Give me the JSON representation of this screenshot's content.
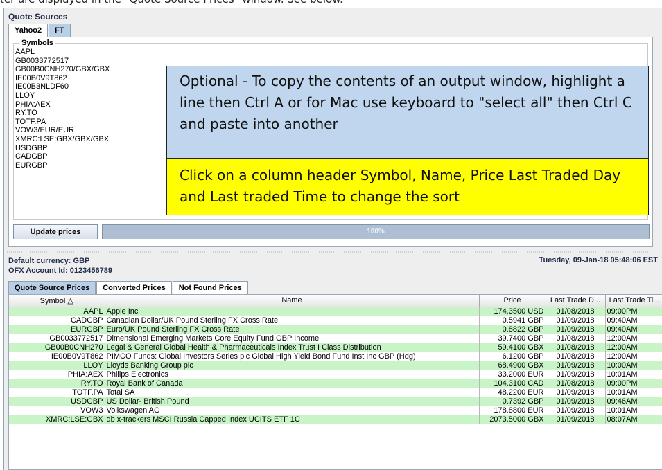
{
  "top_caption": "ter are displayed in the \"Quote Source Prices\" window. See below.",
  "quote_sources": {
    "title": "Quote Sources",
    "tabs": [
      "Yahoo2",
      "FT"
    ],
    "symbols_label": "Symbols",
    "symbols": [
      "AAPL",
      "GB0033772517",
      "GB00B0CNH270/GBX/GBX",
      "IE00B0V9T862",
      "IE00B3NLDF60",
      "LLOY",
      "PHIA:AEX",
      "RY.TO",
      "TOTF.PA",
      "VOW3/EUR/EUR",
      "XMRC:LSE:GBX/GBX/GBX",
      "USDGBP",
      "CADGBP",
      "EURGBP"
    ],
    "update_button": "Update prices",
    "progress_percent": 100,
    "progress_label": "100%"
  },
  "callouts": {
    "blue": "Optional - To copy the contents of an output window, highlight a line then Ctrl A or for Mac use keyboard to \"select all\" then Ctrl C and paste into another",
    "yellow": "Click on a column header Symbol, Name, Price Last Traded Day and Last traded Time to change the sort"
  },
  "info": {
    "default_currency": "Default currency: GBP",
    "ofx_account": "OFX Account Id: 0123456789",
    "timestamp": "Tuesday, 09-Jan-18 05:48:06 EST"
  },
  "price_tabs": [
    "Quote Source Prices",
    "Converted Prices",
    "Not Found Prices"
  ],
  "table": {
    "columns": [
      "Symbol △",
      "Name",
      "Price",
      "Last Trade D...",
      "Last Trade Ti..."
    ],
    "rows": [
      [
        "AAPL",
        "Apple Inc",
        "174.3500 USD",
        "01/08/2018",
        "09:00PM"
      ],
      [
        "CADGBP",
        "Canadian Dollar/UK Pound Sterling FX Cross Rate",
        "0.5941 GBP",
        "01/09/2018",
        "09:40AM"
      ],
      [
        "EURGBP",
        "Euro/UK Pound Sterling FX Cross Rate",
        "0.8822 GBP",
        "01/09/2018",
        "09:40AM"
      ],
      [
        "GB0033772517",
        "Dimensional Emerging Markets Core Equity Fund GBP Income",
        "39.7400 GBP",
        "01/08/2018",
        "12:00AM"
      ],
      [
        "GB00B0CNH270",
        "Legal & General Global Health & Pharmaceuticals Index Trust I Class Distribution",
        "59.4100 GBX",
        "01/08/2018",
        "12:00AM"
      ],
      [
        "IE00B0V9T862",
        "PIMCO Funds: Global Investors Series plc Global High Yield Bond Fund Inst Inc GBP (Hdg)",
        "6.1200 GBP",
        "01/08/2018",
        "12:00AM"
      ],
      [
        "LLOY",
        "Lloyds Banking Group plc",
        "68.4900 GBX",
        "01/09/2018",
        "10:00AM"
      ],
      [
        "PHIA:AEX",
        "Philips Electronics",
        "33.2000 EUR",
        "01/09/2018",
        "10:01AM"
      ],
      [
        "RY.TO",
        "Royal Bank of Canada",
        "104.3100 CAD",
        "01/08/2018",
        "09:00PM"
      ],
      [
        "TOTF.PA",
        "Total SA",
        "48.2200 EUR",
        "01/09/2018",
        "10:01AM"
      ],
      [
        "USDGBP",
        "US Dollar- British Pound",
        "0.7392 GBP",
        "01/09/2018",
        "09:46AM"
      ],
      [
        "VOW3",
        "Volkswagen AG",
        "178.8800 EUR",
        "01/09/2018",
        "10:01AM"
      ],
      [
        "XMRC:LSE:GBX",
        "db x-trackers MSCI Russia Capped Index UCITS ETF 1C",
        "2073.5000 GBX",
        "01/09/2018",
        "08:07AM"
      ]
    ]
  }
}
